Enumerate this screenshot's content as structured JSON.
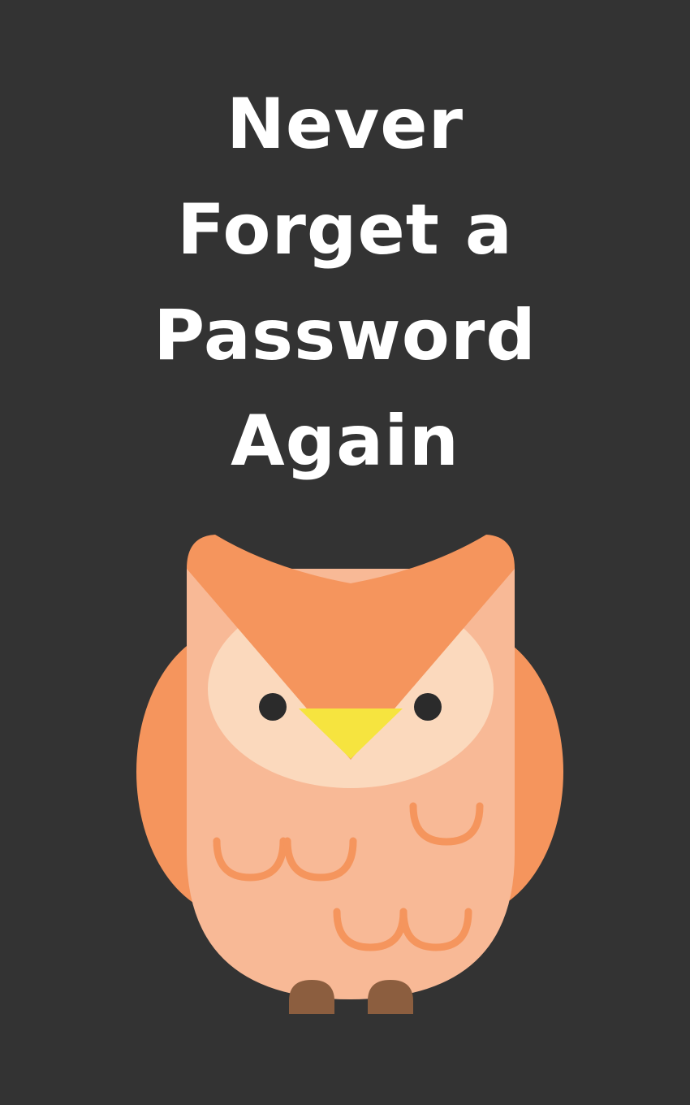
{
  "cover": {
    "title_lines": [
      "Never",
      "Forget a",
      "Password",
      "Again"
    ],
    "background_color": "#333333",
    "text_color": "#ffffff"
  },
  "illustration": {
    "subject": "owl-icon",
    "colors": {
      "wing": "#f5955d",
      "body": "#f8b996",
      "face": "#fbd9bd",
      "beak": "#f6e43f",
      "eye": "#2b2b2b",
      "feet": "#8c5e3f",
      "feather_marks": "#f5955d"
    }
  }
}
